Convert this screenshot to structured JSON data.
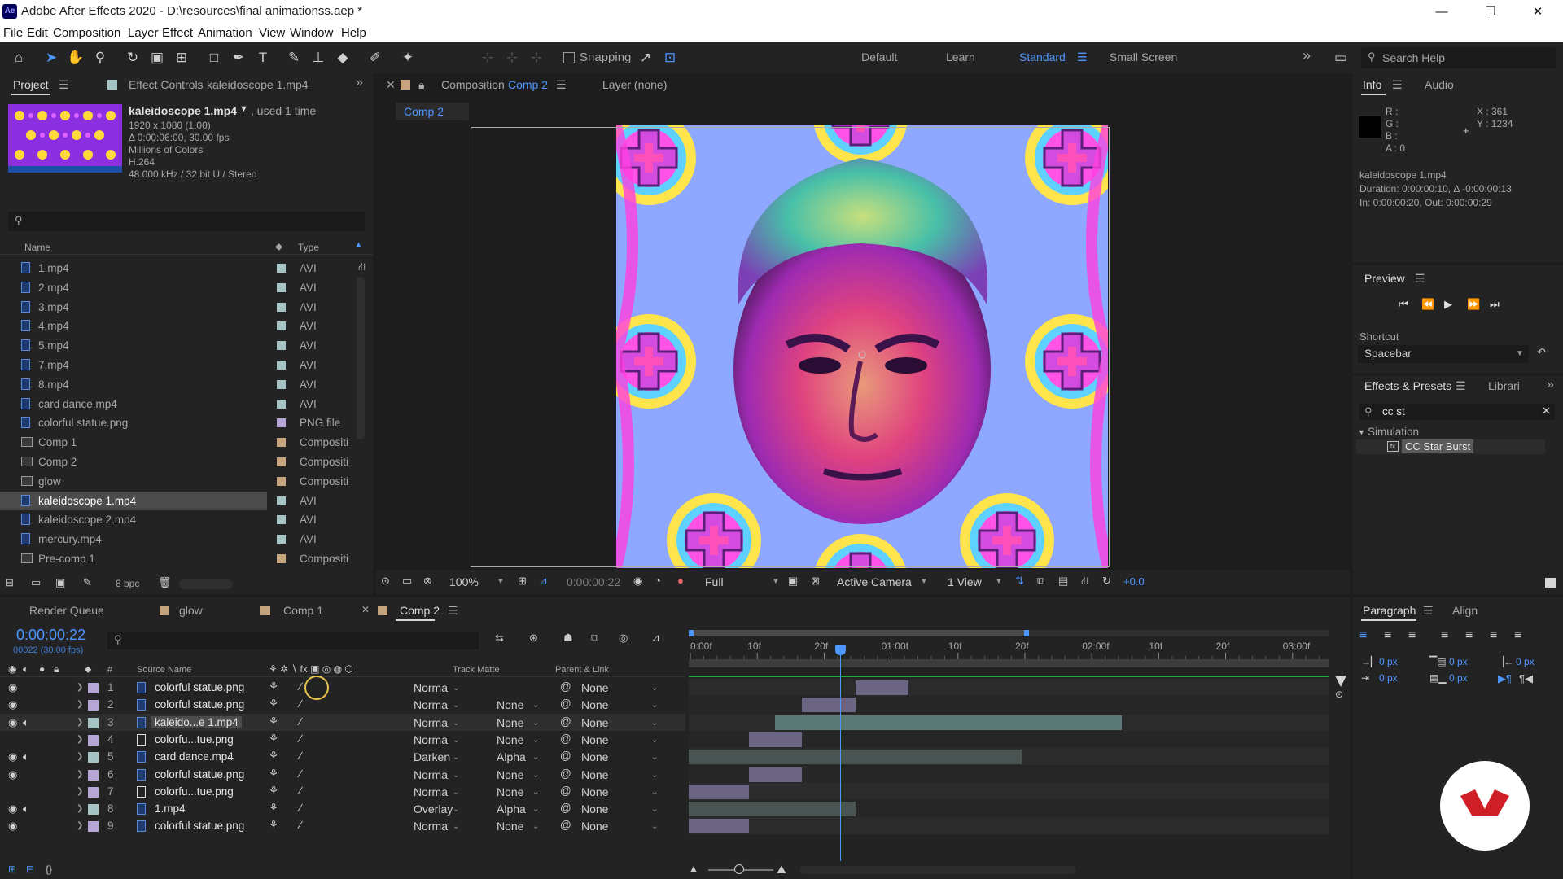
{
  "window": {
    "app_badge": "Ae",
    "title": "Adobe After Effects 2020 - D:\\resources\\final animationss.aep *",
    "minimize": "—",
    "restore": "❐",
    "close": "✕"
  },
  "menu": [
    "File",
    "Edit",
    "Composition",
    "Layer",
    "Effect",
    "Animation",
    "View",
    "Window",
    "Help"
  ],
  "toolbar": {
    "snapping": "Snapping",
    "workspaces": [
      "Default",
      "Learn",
      "Standard",
      "Small Screen"
    ],
    "active_workspace": "Standard",
    "search_placeholder": "Search Help",
    "more": "»"
  },
  "project": {
    "tab_project": "Project",
    "tab_effect_controls": "Effect Controls",
    "effect_controls_target": "kaleidoscope 1.mp4",
    "thumb_name": "kaleidoscope 1.mp4",
    "thumb_used": ", used 1 time",
    "info_lines": [
      "1920 x 1080 (1.00)",
      "Δ 0:00:06:00, 30.00 fps",
      "Millions of Colors",
      "H.264",
      "48.000 kHz / 32 bit U / Stereo"
    ],
    "col_name": "Name",
    "col_type": "Type",
    "items": [
      {
        "name": "1.mp4",
        "type": "AVI",
        "kind": "file",
        "color": "#a6c4c4"
      },
      {
        "name": "2.mp4",
        "type": "AVI",
        "kind": "file",
        "color": "#a6c4c4"
      },
      {
        "name": "3.mp4",
        "type": "AVI",
        "kind": "file",
        "color": "#a6c4c4"
      },
      {
        "name": "4.mp4",
        "type": "AVI",
        "kind": "file",
        "color": "#a6c4c4"
      },
      {
        "name": "5.mp4",
        "type": "AVI",
        "kind": "file",
        "color": "#a6c4c4"
      },
      {
        "name": "7.mp4",
        "type": "AVI",
        "kind": "file",
        "color": "#a6c4c4"
      },
      {
        "name": "8.mp4",
        "type": "AVI",
        "kind": "file",
        "color": "#a6c4c4"
      },
      {
        "name": "card dance.mp4",
        "type": "AVI",
        "kind": "file",
        "color": "#a6c4c4"
      },
      {
        "name": "colorful statue.png",
        "type": "PNG file",
        "kind": "file",
        "color": "#b5a6d6"
      },
      {
        "name": "Comp 1",
        "type": "Compositi",
        "kind": "comp",
        "color": "#c6a47e"
      },
      {
        "name": "Comp 2",
        "type": "Compositi",
        "kind": "comp",
        "color": "#c6a47e"
      },
      {
        "name": "glow",
        "type": "Compositi",
        "kind": "comp",
        "color": "#c6a47e"
      },
      {
        "name": "kaleidoscope 1.mp4",
        "type": "AVI",
        "kind": "file",
        "color": "#a6c4c4",
        "selected": true
      },
      {
        "name": "kaleidoscope 2.mp4",
        "type": "AVI",
        "kind": "file",
        "color": "#a6c4c4"
      },
      {
        "name": "mercury.mp4",
        "type": "AVI",
        "kind": "file",
        "color": "#a6c4c4"
      },
      {
        "name": "Pre-comp 1",
        "type": "Compositi",
        "kind": "comp",
        "color": "#c6a47e"
      }
    ],
    "bpc": "8 bpc"
  },
  "comp_viewer": {
    "tab_prefix": "Composition",
    "tab_comp": "Comp 2",
    "tab_layer": "Layer  (none)",
    "crumb": "Comp 2",
    "zoom": "100%",
    "timecode": "0:00:00:22",
    "resolution": "Full",
    "camera": "Active Camera",
    "views": "1 View",
    "exposure": "+0.0"
  },
  "info": {
    "tab_info": "Info",
    "tab_audio": "Audio",
    "r": "R :",
    "g": "G :",
    "b": "B :",
    "a": "A :  0",
    "x": "X : 361",
    "y": "Y : 1234",
    "lines": [
      "kaleidoscope 1.mp4",
      "Duration: 0:00:00:10, Δ -0:00:00:13",
      "In: 0:00:00:20, Out: 0:00:00:29"
    ]
  },
  "preview": {
    "tab": "Preview",
    "shortcut_label": "Shortcut",
    "shortcut_value": "Spacebar"
  },
  "effects": {
    "tab": "Effects & Presets",
    "tab_lib": "Librari",
    "search": "cc st",
    "category": "Simulation",
    "item": "CC Star Burst"
  },
  "timeline": {
    "tab_render": "Render Queue",
    "tab_glow": "glow",
    "tab_comp1": "Comp 1",
    "tab_comp2": "Comp 2",
    "timecode": "0:00:00:22",
    "subcode": "00022 (30.00 fps)",
    "col_source": "Source Name",
    "col_track": "Track Matte",
    "col_parent": "Parent & Link",
    "ruler": [
      "0:00f",
      "10f",
      "20f",
      "01:00f",
      "10f",
      "20f",
      "02:00f",
      "10f",
      "20f",
      "03:00f"
    ],
    "layers": [
      {
        "num": "1",
        "name": "colorful statue.png",
        "mode": "Norma",
        "matte": "",
        "parent": "None",
        "color": "#b5a6d6",
        "kind": "file",
        "eye": true,
        "audio": false,
        "sel": false
      },
      {
        "num": "2",
        "name": "colorful statue.png",
        "mode": "Norma",
        "matte": "None",
        "parent": "None",
        "color": "#b5a6d6",
        "kind": "file",
        "eye": true,
        "audio": false,
        "sel": false
      },
      {
        "num": "3",
        "name": "kaleido...e 1.mp4",
        "mode": "Norma",
        "matte": "None",
        "parent": "None",
        "color": "#a6c4c4",
        "kind": "file",
        "eye": true,
        "audio": true,
        "sel": true
      },
      {
        "num": "4",
        "name": "colorfu...tue.png",
        "mode": "Norma",
        "matte": "None",
        "parent": "None",
        "color": "#b5a6d6",
        "kind": "comp",
        "eye": false,
        "audio": false,
        "sel": false
      },
      {
        "num": "5",
        "name": "card dance.mp4",
        "mode": "Darken",
        "matte": "Alpha",
        "parent": "None",
        "color": "#a6c4c4",
        "kind": "file",
        "eye": true,
        "audio": true,
        "sel": false
      },
      {
        "num": "6",
        "name": "colorful statue.png",
        "mode": "Norma",
        "matte": "None",
        "parent": "None",
        "color": "#b5a6d6",
        "kind": "file",
        "eye": true,
        "audio": false,
        "sel": false
      },
      {
        "num": "7",
        "name": "colorfu...tue.png",
        "mode": "Norma",
        "matte": "None",
        "parent": "None",
        "color": "#b5a6d6",
        "kind": "comp",
        "eye": false,
        "audio": false,
        "sel": false
      },
      {
        "num": "8",
        "name": "1.mp4",
        "mode": "Overlay",
        "matte": "Alpha",
        "parent": "None",
        "color": "#a6c4c4",
        "kind": "file",
        "eye": true,
        "audio": true,
        "sel": false
      },
      {
        "num": "9",
        "name": "colorful statue.png",
        "mode": "Norma",
        "matte": "None",
        "parent": "None",
        "color": "#b5a6d6",
        "kind": "file",
        "eye": true,
        "audio": false,
        "sel": false
      }
    ]
  },
  "paragraph": {
    "tab": "Paragraph",
    "tab_align": "Align",
    "px": [
      "0 px",
      "0 px",
      "0 px",
      "0 px",
      "0 px"
    ]
  },
  "colors": {
    "accent": "#2d8ceb",
    "timecode": "#4d96ff",
    "workarea": "#3d3d3d"
  }
}
